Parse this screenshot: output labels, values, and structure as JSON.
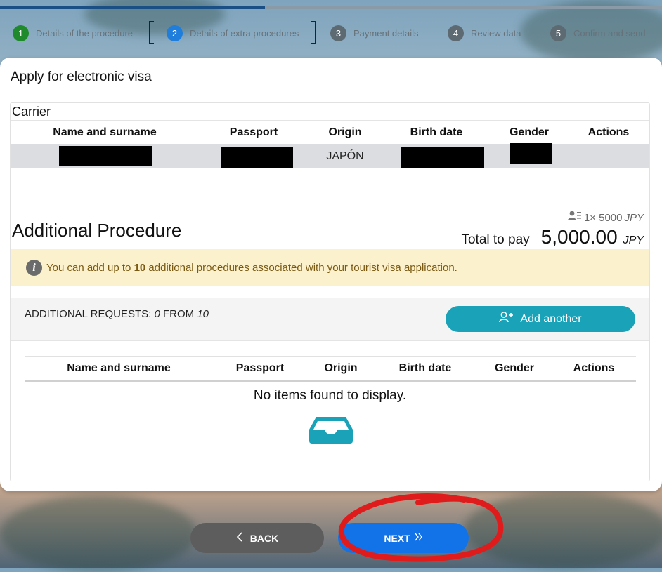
{
  "progress": {
    "fraction": 0.4
  },
  "steps": [
    {
      "num": "1",
      "label": "Details of the procedure",
      "state": "done"
    },
    {
      "num": "2",
      "label": "Details of extra procedures",
      "state": "active"
    },
    {
      "num": "3",
      "label": "Payment details",
      "state": "pending"
    },
    {
      "num": "4",
      "label": "Review data",
      "state": "pending"
    },
    {
      "num": "5",
      "label": "Confirm and send",
      "state": "pending"
    }
  ],
  "card": {
    "title": "Apply for electronic visa"
  },
  "carrier": {
    "label": "Carrier",
    "columns": [
      "Name and surname",
      "Passport",
      "Origin",
      "Birth date",
      "Gender",
      "Actions"
    ],
    "row": {
      "origin": "JAPÓN"
    }
  },
  "additional": {
    "title": "Additional Procedure",
    "unit_price": "1× 5000",
    "unit_currency": "JPY",
    "total_label": "Total to pay",
    "total_amount": "5,000.00",
    "total_currency": "JPY",
    "notice_prefix": "You can add up to ",
    "notice_max": "10",
    "notice_suffix": " additional procedures associated with your tourist visa application.",
    "requests_label": "ADDITIONAL REQUESTS: ",
    "requests_count": "0",
    "requests_from": " FROM ",
    "requests_max": "10",
    "add_button": "Add another",
    "columns": [
      "Name and surname",
      "Passport",
      "Origin",
      "Birth date",
      "Gender",
      "Actions"
    ],
    "empty_text": "No items found to display."
  },
  "nav": {
    "back": "BACK",
    "next": "NEXT"
  },
  "colors": {
    "accent": "#1aa3b8",
    "next": "#1273e8",
    "back": "#5d5d5d",
    "annotation": "#e01b1b"
  },
  "icons": [
    "user-list-icon",
    "info-icon",
    "user-plus-icon",
    "empty-inbox-icon",
    "chevron-left-icon",
    "double-chevron-right-icon"
  ]
}
